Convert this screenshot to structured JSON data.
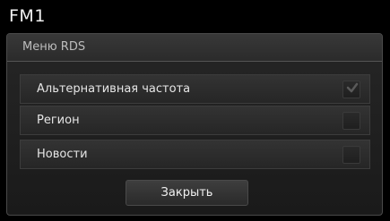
{
  "header": {
    "title": "FM1"
  },
  "dialog": {
    "title": "Меню RDS",
    "options": [
      {
        "label": "Альтернативная частота",
        "checked": true
      },
      {
        "label": "Регион",
        "checked": false
      },
      {
        "label": "Новости",
        "checked": false
      }
    ],
    "close_label": "Закрыть"
  },
  "colors": {
    "background": "#000000",
    "dialog_bg": "#1f1f1f",
    "row_bg": "#2c2c2c",
    "text": "#e6e6e6",
    "muted_text": "#bdbdbd"
  },
  "icons": {
    "checkbox": "check-icon"
  }
}
